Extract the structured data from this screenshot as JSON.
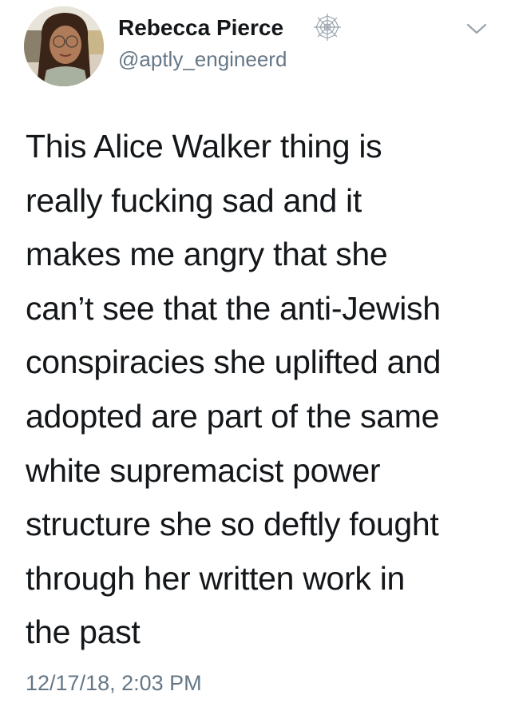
{
  "author": {
    "display_name": "Rebecca Pierce",
    "handle": "@aptly_engineerd",
    "badge_icon": "spiderweb-icon"
  },
  "menu": {
    "icon": "chevron-down-icon"
  },
  "tweet": {
    "lines": [
      "This Alice Walker thing is",
      "really fucking sad and it",
      "makes me angry that she",
      "can’t see that the anti-Jewish",
      "conspiracies she uplifted and",
      "adopted are part of the same",
      "white supremacist power",
      "structure she so deftly fought",
      "through her written work in",
      "the past"
    ],
    "timestamp": "12/17/18, 2:03 PM"
  },
  "colors": {
    "text": "#14171a",
    "secondary": "#657786",
    "background": "#ffffff"
  }
}
